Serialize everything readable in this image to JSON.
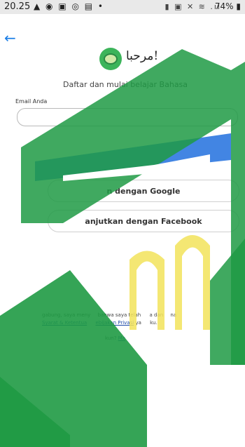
{
  "status_bar": {
    "time": "20.25",
    "battery": "74%"
  },
  "header": {
    "greeting": "مرحبا!"
  },
  "intro": {
    "subtitle": "Daftar dan mulai belajar Bahasa"
  },
  "form": {
    "email_label": "Email Anda",
    "email_value": "",
    "email_placeholder": ""
  },
  "social": {
    "google_label": "n dengan Google",
    "facebook_label": "anjutkan dengan Facebook"
  },
  "footer": {
    "terms_prefix": "gabung, saya meny",
    "terms_mid1": "bahwa saya telah",
    "terms_mid2": "a dan",
    "terms_tail": "na",
    "terms_link1": "Syarat & Ketentua",
    "terms_link2": "ebijakan Privasi",
    "terms_end": "ya",
    "terms_end2": "ku.",
    "login_prompt": "kun?",
    "login_link": "Ma"
  },
  "watermark_colors": {
    "green": "#1f9a44",
    "yellow": "#f2e35a"
  }
}
